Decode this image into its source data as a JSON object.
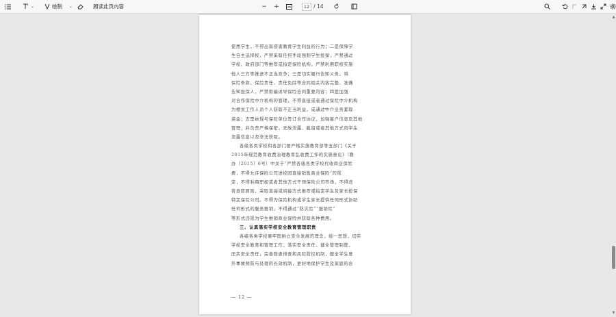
{
  "toolbar": {
    "highlight_label": "绘制",
    "read_aloud_label": "朗读此页内容",
    "page_current": "12",
    "page_total": "/ 14",
    "minus": "−",
    "plus": "+",
    "chevron": "⌄"
  },
  "document": {
    "lines": [
      "使用学生，不得出现侵害教育学生利益的行为；二是保障学",
      "生自主选择权，严禁采取任何手段强制学生投保，严禁通过",
      "学校、政府部门等推荐或指定保险机构，严禁利用职权实施",
      "他人三方等推进不正当竞争；三是切实履行告知义务，将",
      "保险条款、保险责任、责任免除等合同相关内容完整、准确",
      "告知投保人，严禁欺骗诱导保险合同重要内容；四是加强",
      "对合作保险中介机构的管理，不得直接或者通过保险中介机构",
      "为相关工作人员个人获取不正当利益，或通过中介业务套取",
      "资金；五是依规与保险单位签订合作协议，加强客户信息及其他",
      "管理，并负责严格保密，无故泄露、截留或者其他方式向学生",
      "泄露信息以及非法获取。",
      "各级各类学校和各部门要严格实施教育部等五部门《关于",
      "2015年规范教育收费治理教育乱收费工作的实施意见》（教",
      "办〔2015〕6号）中关于“严禁各级各类学校代收商业保险",
      "费，不得允许保险公司进校园直接销售商业保险”的规",
      "定，不得利用职权或者其他方式干预保险公司市场，不得违",
      "背自愿原则，采取直接或间接方式推荐或指定学生及家长投保",
      "特定保险公司。不得为保险机构或学生家长提供任何形式协助",
      "任何形式的服务推销，不得通过“防灾险”“报销险”",
      "等形式违规为学生推销商业保险并获取各种费用。"
    ],
    "heading": "三、认真落实学校安全教育管理职责",
    "lines_after": [
      "各级各类学校要牢固树立安全发展的理念，统一思想，切实",
      "学校安全教育和管理工作，落实安全责任，健全管理制度，",
      "压实安全责任，完善隐患排查和风险防控机制，健全学生意",
      "外事故预防与处理的长效机制，更好地保护学生及家庭的合"
    ],
    "page_number": "— 12 —"
  }
}
